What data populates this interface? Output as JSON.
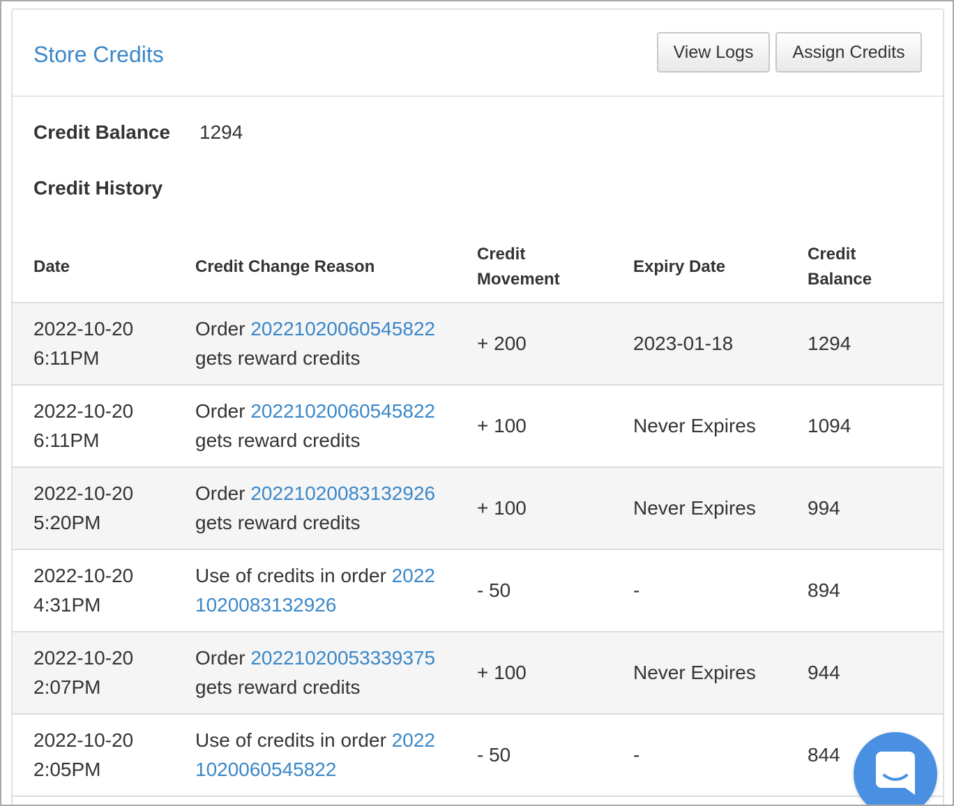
{
  "panel": {
    "title": "Store Credits",
    "view_logs_label": "View Logs",
    "assign_credits_label": "Assign Credits"
  },
  "balance": {
    "label": "Credit Balance",
    "value": "1294"
  },
  "history": {
    "label": "Credit History",
    "columns": {
      "date": "Date",
      "reason": "Credit Change Reason",
      "movement": "Credit Movement",
      "expiry": "Expiry Date",
      "balance": "Credit Balance"
    },
    "rows": [
      {
        "date": "2022-10-20 6:11PM",
        "reason_prefix": "Order ",
        "order": "20221020060545822",
        "reason_suffix": " gets reward credits",
        "movement": "+ 200",
        "expiry": "2023-01-18",
        "balance": "1294"
      },
      {
        "date": "2022-10-20 6:11PM",
        "reason_prefix": "Order ",
        "order": "20221020060545822",
        "reason_suffix": " gets reward credits",
        "movement": "+ 100",
        "expiry": "Never Expires",
        "balance": "1094"
      },
      {
        "date": "2022-10-20 5:20PM",
        "reason_prefix": "Order ",
        "order": "20221020083132926",
        "reason_suffix": " gets reward credits",
        "movement": "+ 100",
        "expiry": "Never Expires",
        "balance": "994"
      },
      {
        "date": "2022-10-20 4:31PM",
        "reason_prefix": "Use of credits in order ",
        "order": "20221020083132926",
        "reason_suffix": "",
        "movement": "- 50",
        "expiry": "-",
        "balance": "894"
      },
      {
        "date": "2022-10-20 2:07PM",
        "reason_prefix": "Order ",
        "order": "20221020053339375",
        "reason_suffix": " gets reward credits",
        "movement": "+ 100",
        "expiry": "Never Expires",
        "balance": "944"
      },
      {
        "date": "2022-10-20 2:05PM",
        "reason_prefix": "Use of credits in order ",
        "order": "20221020060545822",
        "reason_suffix": "",
        "movement": "- 50",
        "expiry": "-",
        "balance": "844"
      }
    ]
  },
  "chat": {
    "icon": "chat-icon",
    "color": "#4a90e2"
  },
  "colors": {
    "link": "#3a87c8",
    "stripe": "#f5f5f5"
  }
}
